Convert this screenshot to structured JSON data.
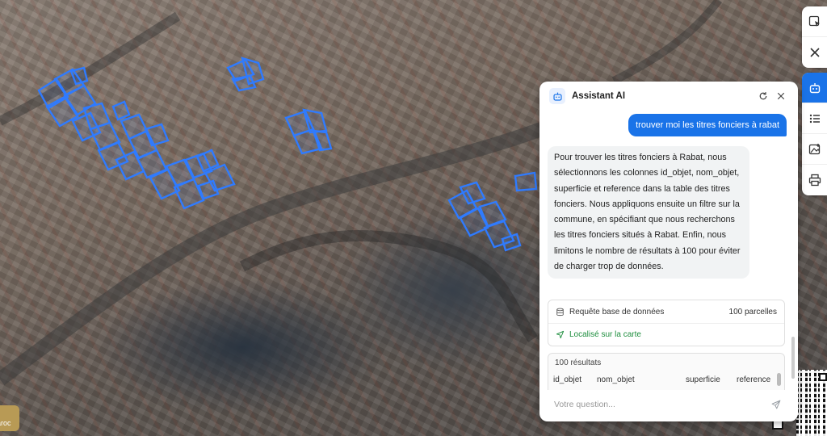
{
  "map": {
    "attribution_text": "aroc"
  },
  "toolbar": {
    "items": [
      {
        "icon": "cursor-select-icon"
      },
      {
        "icon": "close-icon"
      },
      {
        "icon": "robot-icon",
        "active": true
      },
      {
        "icon": "list-icon"
      },
      {
        "icon": "image-add-icon"
      },
      {
        "icon": "print-icon"
      }
    ]
  },
  "assistant": {
    "title": "Assistant AI",
    "user_message": "trouver moi les titres fonciers à rabat",
    "ai_message": "Pour trouver les titres fonciers à Rabat, nous sélectionnons les colonnes id_objet, nom_objet, superficie et reference dans la table des titres fonciers. Nous appliquons ensuite un filtre sur la commune, en spécifiant que nous recherchons les titres fonciers situés à Rabat. Enfin, nous limitons le nombre de résultats à 100 pour éviter de charger trop de données.",
    "tool": {
      "query_label": "Requête base de données",
      "query_count": "100 parcelles",
      "located_label": "Localisé sur la carte"
    },
    "results": {
      "count_label": "100 résultats",
      "columns": [
        "id_objet",
        "nom_objet",
        "superficie",
        "reference"
      ]
    },
    "input": {
      "placeholder": "Votre question..."
    },
    "colors": {
      "accent": "#1a73e8",
      "parcel_outline": "#2f7bff",
      "success": "#1e8e3e"
    }
  }
}
